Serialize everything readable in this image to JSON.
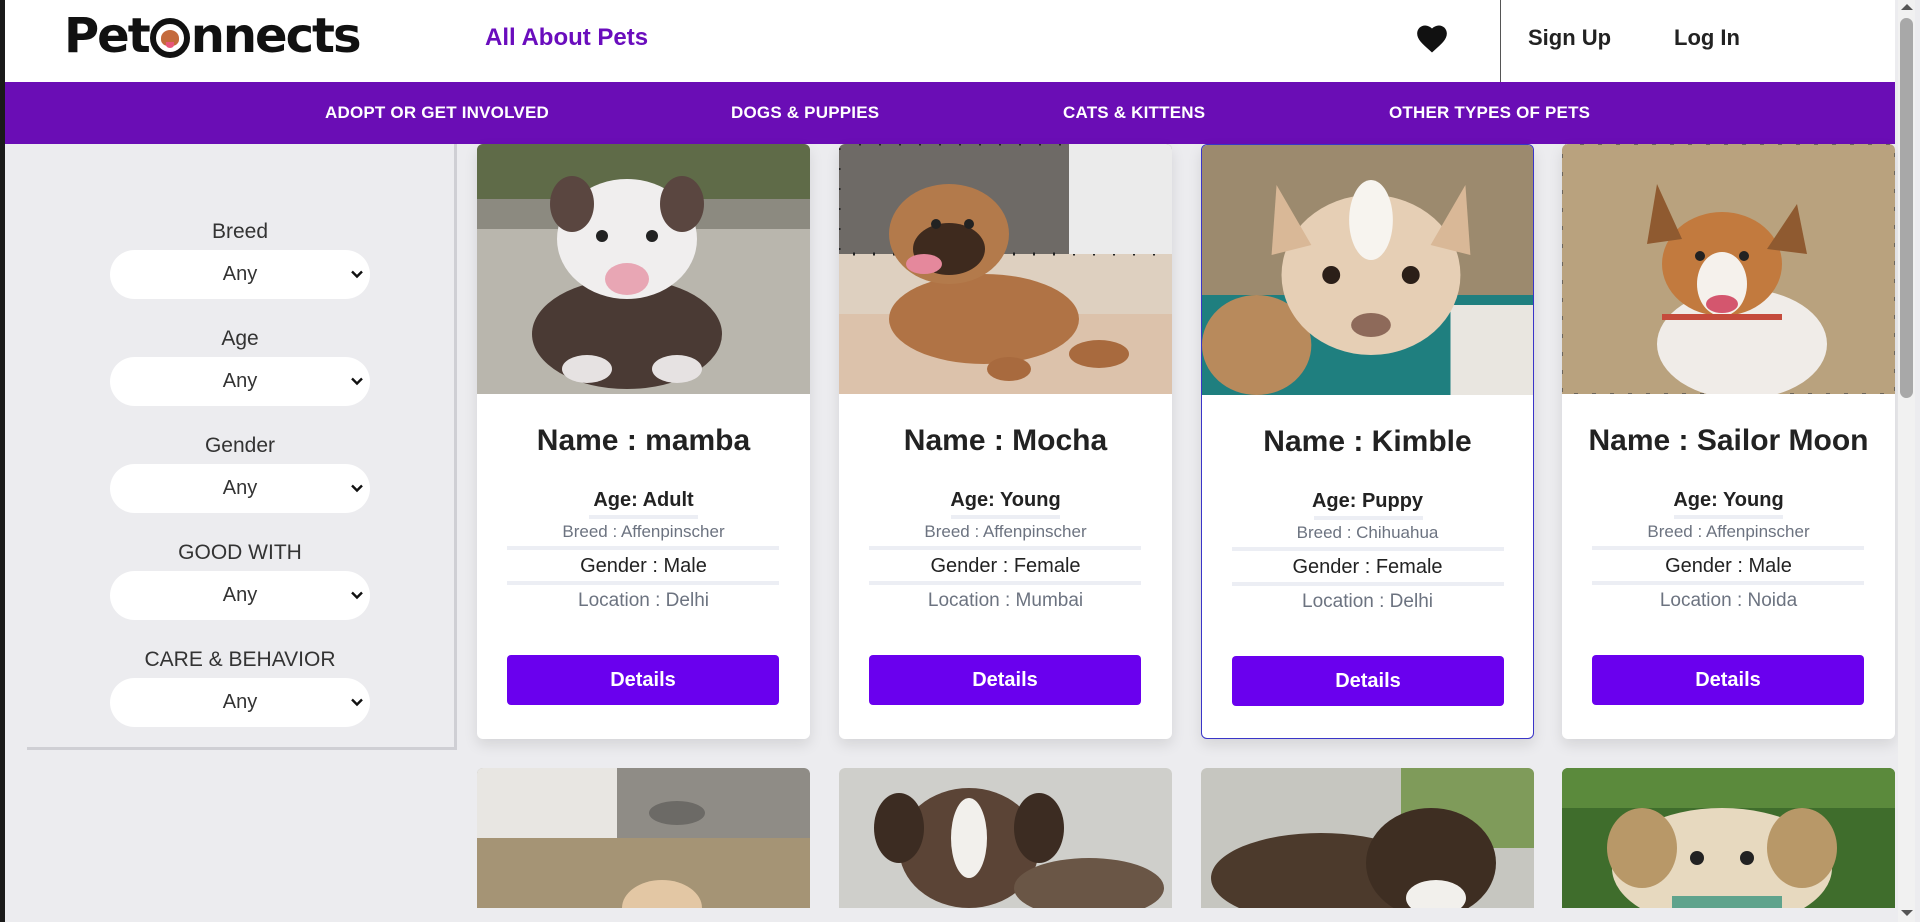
{
  "header": {
    "brand": "PetConnects",
    "brand_pre": "Pet",
    "brand_post": "nnects",
    "tagline": "All About Pets",
    "signup": "Sign Up",
    "login": "Log In",
    "icon": "heart-icon"
  },
  "nav": [
    "ADOPT OR GET INVOLVED",
    "DOGS & PUPPIES",
    "CATS & KITTENS",
    "OTHER TYPES OF PETS"
  ],
  "filters": [
    {
      "label": "Breed",
      "value": "Any"
    },
    {
      "label": "Age",
      "value": "Any"
    },
    {
      "label": "Gender",
      "value": "Any"
    },
    {
      "label": "GOOD WITH",
      "value": "Any"
    },
    {
      "label": "CARE & BEHAVIOR",
      "value": "Any"
    }
  ],
  "pets": [
    {
      "name": "Name : mamba",
      "age": "Age: Adult",
      "breed": "Breed : Affenpinscher",
      "gender": "Gender : Male",
      "location": "Location : Delhi",
      "button": "Details"
    },
    {
      "name": "Name : Mocha",
      "age": "Age: Young",
      "breed": "Breed : Affenpinscher",
      "gender": "Gender : Female",
      "location": "Location : Mumbai",
      "button": "Details"
    },
    {
      "name": "Name : Kimble",
      "age": "Age: Puppy",
      "breed": "Breed : Chihuahua",
      "gender": "Gender : Female",
      "location": "Location : Delhi",
      "button": "Details"
    },
    {
      "name": "Name : Sailor Moon",
      "age": "Age: Young",
      "breed": "Breed : Affenpinscher",
      "gender": "Gender : Male",
      "location": "Location : Noida",
      "button": "Details"
    }
  ],
  "colors": {
    "brand_purple": "#6a0db5",
    "button_purple": "#6a00ee",
    "tagline_purple": "#6a0dbd"
  }
}
